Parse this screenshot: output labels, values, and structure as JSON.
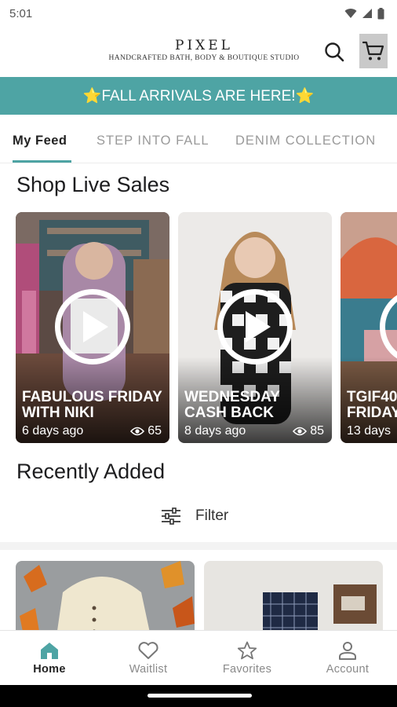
{
  "status": {
    "time": "5:01"
  },
  "header": {
    "brand": "PIXEL",
    "tagline": "HANDCRAFTED BATH, BODY & BOUTIQUE STUDIO",
    "search_icon": "search-icon",
    "cart_icon": "cart-icon"
  },
  "banner": {
    "text": "⭐FALL ARRIVALS ARE HERE!⭐"
  },
  "tabs": [
    {
      "label": "My Feed",
      "active": true
    },
    {
      "label": "STEP INTO FALL",
      "active": false
    },
    {
      "label": "DENIM COLLECTION",
      "active": false
    }
  ],
  "live_sales": {
    "title": "Shop Live Sales",
    "cards": [
      {
        "title": "FABULOUS FRIDAY\nWITH NIKI",
        "age": "6 days ago",
        "views": "65"
      },
      {
        "title": "WEDNESDAY\nCASH BACK",
        "age": "8 days ago",
        "views": "85"
      },
      {
        "title": "TGIF40\nFRIDAY",
        "age": "13 days",
        "views": ""
      }
    ]
  },
  "recent": {
    "title": "Recently Added",
    "filter_label": "Filter"
  },
  "nav": [
    {
      "label": "Home",
      "icon": "home-icon",
      "active": true
    },
    {
      "label": "Waitlist",
      "icon": "heart-icon",
      "active": false
    },
    {
      "label": "Favorites",
      "icon": "star-icon",
      "active": false
    },
    {
      "label": "Account",
      "icon": "person-icon",
      "active": false
    }
  ],
  "colors": {
    "accent": "#4ea4a4",
    "banner_text": "#ffffff"
  }
}
